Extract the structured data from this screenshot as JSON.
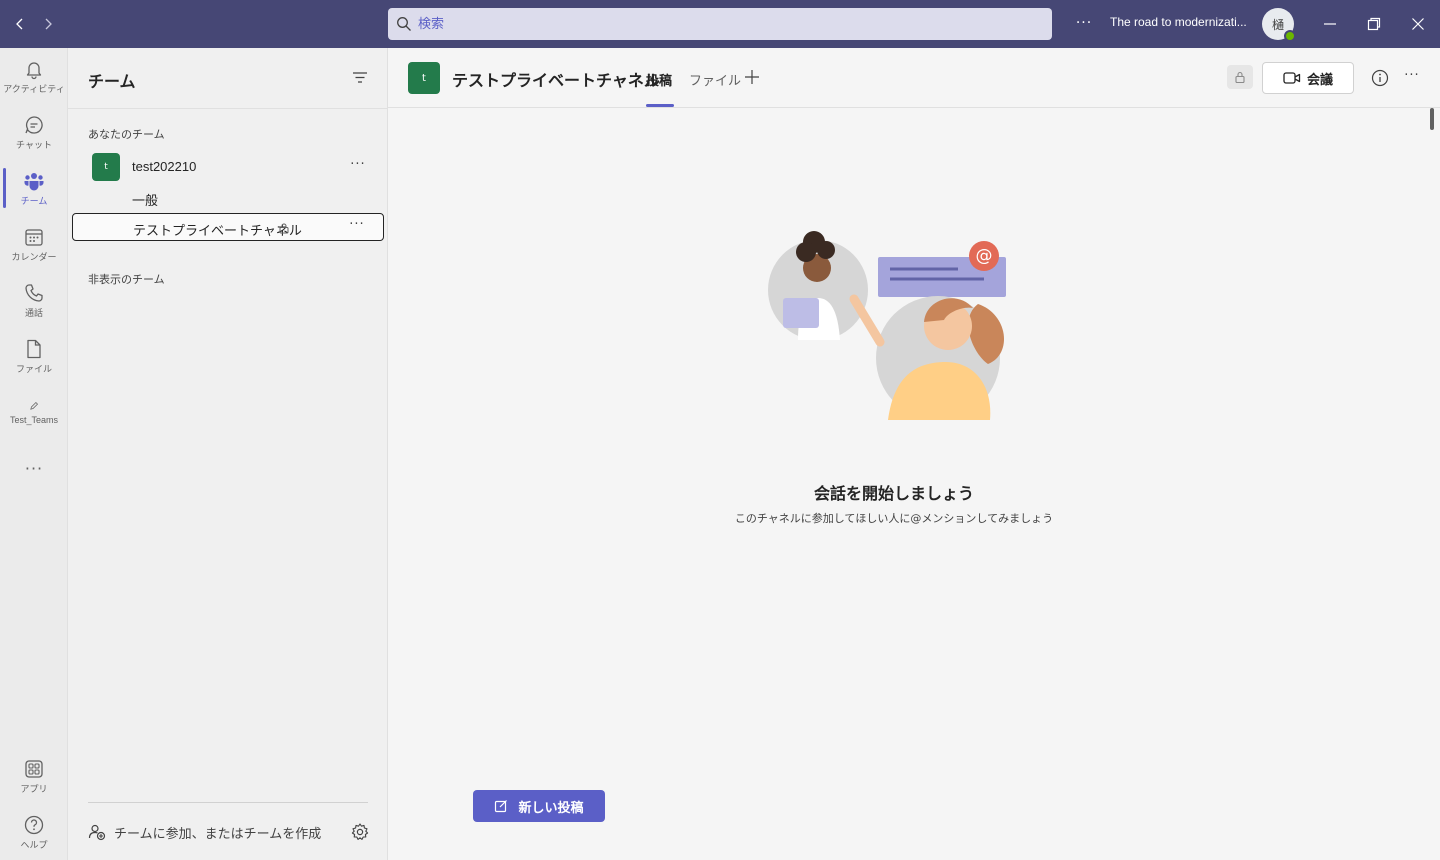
{
  "titlebar": {
    "search_placeholder": "検索",
    "more": "···",
    "org_name": "The road to modernizati...",
    "avatar_initial": "樋"
  },
  "appbar": {
    "items": [
      {
        "label": "アクティビティ",
        "icon": "bell-icon"
      },
      {
        "label": "チャット",
        "icon": "chat-icon"
      },
      {
        "label": "チーム",
        "icon": "teams-icon"
      },
      {
        "label": "カレンダー",
        "icon": "calendar-icon"
      },
      {
        "label": "通話",
        "icon": "phone-icon"
      },
      {
        "label": "ファイル",
        "icon": "file-icon"
      },
      {
        "label": "Test_Teams",
        "icon": "pencil-icon"
      }
    ],
    "more": "···",
    "apps_label": "アプリ",
    "help_label": "ヘルプ",
    "accent": "#5b5fc7"
  },
  "teams_pane": {
    "title": "チーム",
    "your_teams_label": "あなたのチーム",
    "team": {
      "avatar": "t",
      "name": "test202210",
      "more": "···"
    },
    "channels": [
      {
        "name": "一般"
      },
      {
        "name": "テストプライベートチャネル",
        "more": "···"
      }
    ],
    "hidden_teams_label": "非表示のチーム",
    "join_label": "チームに参加、またはチームを作成"
  },
  "channel": {
    "avatar": "t",
    "title": "テストプライベートチャネル",
    "tabs": [
      {
        "label": "投稿"
      },
      {
        "label": "ファイル"
      }
    ],
    "meet_label": "会議",
    "more": "···",
    "empty_title": "会話を開始しましょう",
    "empty_subtitle": "このチャネルに参加してほしい人に@メンションしてみましょう",
    "new_post_label": "新しい投稿"
  }
}
